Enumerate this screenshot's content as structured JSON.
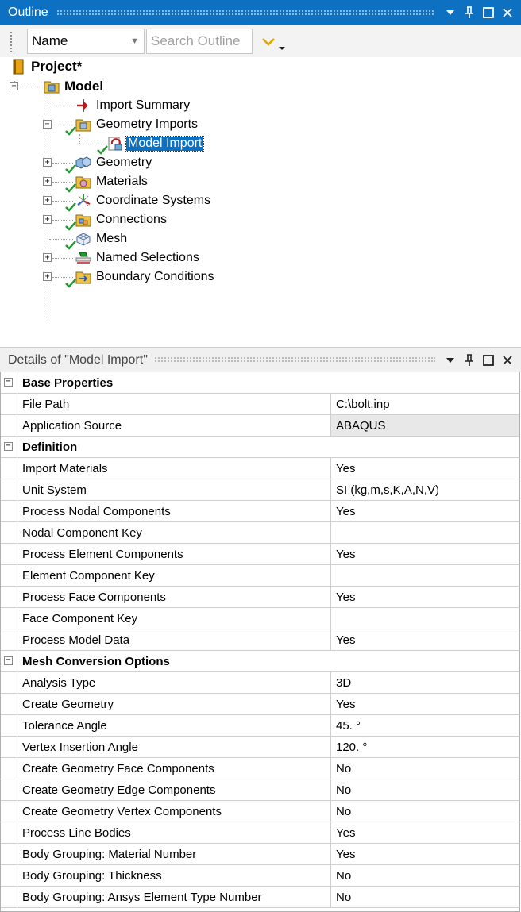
{
  "outline": {
    "title": "Outline",
    "name_select": "Name",
    "search_placeholder": "Search Outline"
  },
  "tree": {
    "project": "Project*",
    "model": "Model",
    "import_summary": "Import Summary",
    "geometry_imports": "Geometry Imports",
    "model_import": "Model Import",
    "geometry": "Geometry",
    "materials": "Materials",
    "coordinate_systems": "Coordinate Systems",
    "connections": "Connections",
    "mesh": "Mesh",
    "named_selections": "Named Selections",
    "boundary_conditions": "Boundary Conditions"
  },
  "details": {
    "title": "Details of \"Model Import\"",
    "rows": [
      {
        "type": "section",
        "label": "Base Properties"
      },
      {
        "label": "File Path",
        "value": "C:\\bolt.inp"
      },
      {
        "label": "Application Source",
        "value": "ABAQUS",
        "readonly": true
      },
      {
        "type": "section",
        "label": "Definition"
      },
      {
        "label": "Import Materials",
        "value": "Yes"
      },
      {
        "label": "Unit System",
        "value": "SI (kg,m,s,K,A,N,V)"
      },
      {
        "label": "Process Nodal Components",
        "value": "Yes"
      },
      {
        "label": "Nodal Component Key",
        "value": ""
      },
      {
        "label": "Process Element Components",
        "value": "Yes"
      },
      {
        "label": "Element Component Key",
        "value": ""
      },
      {
        "label": "Process Face Components",
        "value": "Yes"
      },
      {
        "label": "Face Component Key",
        "value": ""
      },
      {
        "label": "Process Model Data",
        "value": "Yes"
      },
      {
        "type": "section",
        "label": "Mesh Conversion Options"
      },
      {
        "label": "Analysis Type",
        "value": "3D"
      },
      {
        "label": "Create Geometry",
        "value": "Yes"
      },
      {
        "label": "Tolerance Angle",
        "value": "45. °"
      },
      {
        "label": "Vertex Insertion Angle",
        "value": "120. °"
      },
      {
        "label": "Create Geometry Face Components",
        "value": "No"
      },
      {
        "label": "Create Geometry Edge Components",
        "value": "No"
      },
      {
        "label": "Create Geometry Vertex Components",
        "value": "No"
      },
      {
        "label": "Process Line Bodies",
        "value": "Yes"
      },
      {
        "label": "Body Grouping: Material Number",
        "value": "Yes"
      },
      {
        "label": "Body Grouping: Thickness",
        "value": "No"
      },
      {
        "label": "Body Grouping: Ansys Element Type Number",
        "value": "No"
      }
    ]
  },
  "colors": {
    "titlebar": "#0e70c0",
    "selection": "#0e70c0",
    "check": "#1a9a2a"
  }
}
